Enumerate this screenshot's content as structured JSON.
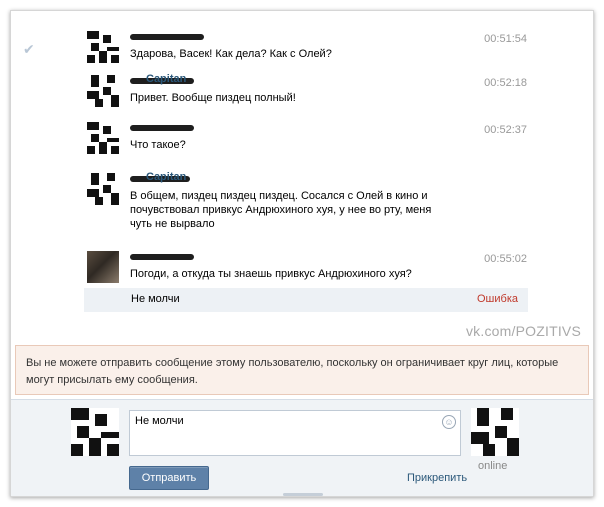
{
  "messages": [
    {
      "time": "00:51:54",
      "text": "Здарова, Васек! Как дела? Как с Олей?",
      "author": ""
    },
    {
      "time": "00:52:18",
      "text": "Привет. Вообще пиздец полный!",
      "author": "Capitan"
    },
    {
      "time": "00:52:37",
      "text": "Что такое?",
      "author": ""
    },
    {
      "time": "",
      "text": "В общем, пиздец пиздец пиздец. Сосался с Олей в кино и почувствовал привкус Андрюхиного хуя, у нее во рту, меня чуть не вырвало",
      "author": "Capitan"
    },
    {
      "time": "00:55:02",
      "text": "Погоди, а откуда ты знаешь привкус Андрюхиного хуя?",
      "author": ""
    }
  ],
  "failed_message": {
    "text": "Не молчи",
    "status": "Ошибка"
  },
  "watermark": "vk.com/POZITIVS",
  "warning": "Вы не можете отправить сообщение этому пользователю, поскольку он ограничивает круг лиц, которые могут присылать ему сообщения.",
  "composer": {
    "input_value": "Не молчи",
    "send_label": "Отправить",
    "attach_label": "Прикрепить",
    "status": "online"
  }
}
